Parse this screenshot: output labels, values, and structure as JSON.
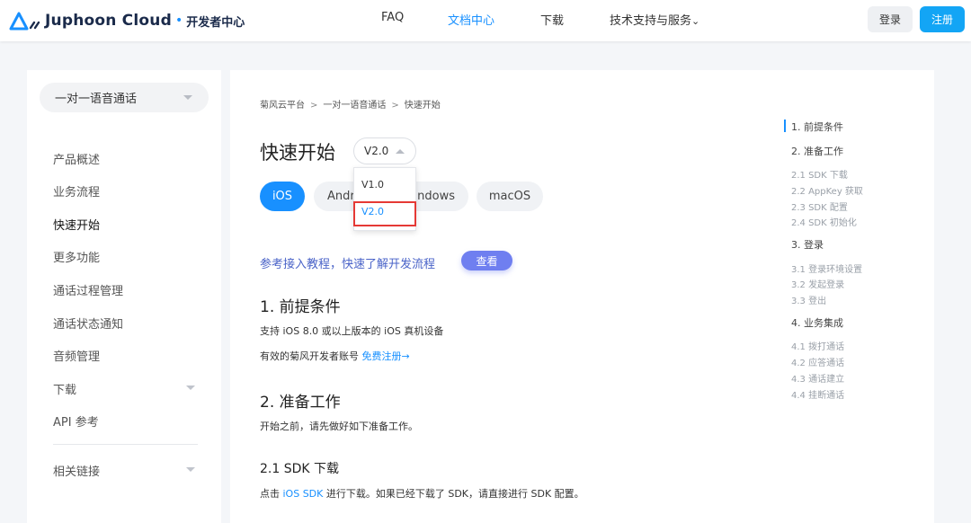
{
  "header": {
    "brand": "Juphoon Cloud",
    "brand_sub": "开发者中心",
    "nav": [
      "FAQ",
      "文档中心",
      "下载",
      "技术支持与服务"
    ],
    "login": "登录",
    "register": "注册"
  },
  "sidebar": {
    "select": "一对一语音通话",
    "items": [
      "产品概述",
      "业务流程",
      "快速开始",
      "更多功能",
      "通话过程管理",
      "通话状态通知",
      "音频管理",
      "下载",
      "API 参考"
    ],
    "footer_item": "相关链接"
  },
  "breadcrumb": [
    "菊风云平台",
    "一对一语音通话",
    "快速开始"
  ],
  "page": {
    "title": "快速开始",
    "version": "V2.0",
    "version_options": [
      "V1.0",
      "V2.0"
    ],
    "tabs": [
      "iOS",
      "Android",
      "Windows",
      "macOS"
    ],
    "tab_andr_visible": "Andr",
    "tab_win_visible": "indows",
    "ref_text": "参考接入教程，快速了解开发流程",
    "ref_button": "查看",
    "s1_title": "1. 前提条件",
    "s1_line1": "支持 iOS 8.0 或以上版本的 iOS 真机设备",
    "s1_line2_prefix": "有效的菊风开发者账号 ",
    "s1_line2_link": "免费注册→",
    "s2_title": "2. 准备工作",
    "s2_line": "开始之前，请先做好如下准备工作。",
    "s21_title": "2.1 SDK 下载",
    "s21_prefix": "点击 ",
    "s21_link": "iOS SDK",
    "s21_suffix": " 进行下载。如果已经下载了 SDK，请直接进行 SDK 配置。"
  },
  "toc": [
    {
      "label": "1. 前提条件",
      "level": 1,
      "active": true
    },
    {
      "label": "2. 准备工作",
      "level": 1
    },
    {
      "label": "2.1 SDK 下载",
      "level": 2
    },
    {
      "label": "2.2 AppKey 获取",
      "level": 2
    },
    {
      "label": "2.3 SDK 配置",
      "level": 2
    },
    {
      "label": "2.4 SDK 初始化",
      "level": 2
    },
    {
      "label": "3. 登录",
      "level": 1
    },
    {
      "label": "3.1 登录环境设置",
      "level": 2
    },
    {
      "label": "3.2 发起登录",
      "level": 2
    },
    {
      "label": "3.3 登出",
      "level": 2
    },
    {
      "label": "4. 业务集成",
      "level": 1
    },
    {
      "label": "4.1 拨打通话",
      "level": 2
    },
    {
      "label": "4.2 应答通话",
      "level": 2
    },
    {
      "label": "4.3 通话建立",
      "level": 2
    },
    {
      "label": "4.4 挂断通话",
      "level": 2
    }
  ],
  "colors": {
    "accent": "#1890ff",
    "register": "#13a5f5",
    "highlight": "#e53935",
    "ref_button": "#6f7ff0"
  }
}
